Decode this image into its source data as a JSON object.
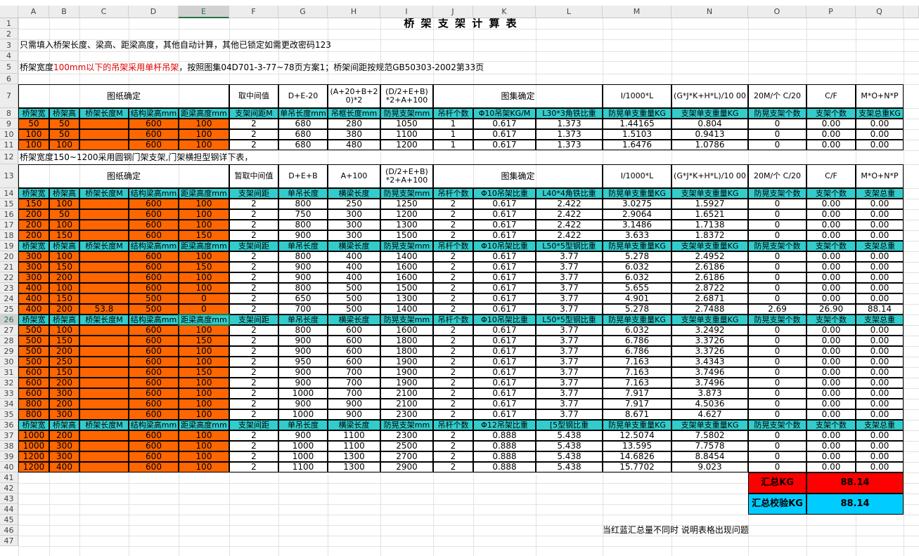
{
  "colors": {
    "orange": "#ff6600",
    "teal": "#33cccc",
    "red_total": "#ff0000",
    "blue_total": "#00ccff"
  },
  "col_letters": [
    "A",
    "B",
    "C",
    "D",
    "E",
    "F",
    "G",
    "H",
    "I",
    "J",
    "K",
    "L",
    "M",
    "N",
    "O",
    "P",
    "Q"
  ],
  "title": "桥 架 支 架 计 算 表",
  "notes": {
    "r3": "只需填入桥架长度、梁高、距梁高度，其他自动计算，其他已锁定如需更改密码123",
    "r5_a": "桥架宽度",
    "r5_b": "100mm以下的吊架采用单杆吊架",
    "r5_c": "，按照图集04D701-3-77~78页方案1；桥架间距按规范GB50303-2002第33页",
    "r12": "桥架宽度150~1200采用圆钢门架支架,门架横担型钢详下表，"
  },
  "section1_header": [
    "图纸确定",
    "取中间值",
    "D+E-20",
    "(A+20+B+2 0)*2",
    "(D/2+E+B) *2+A+100",
    "图集确定",
    "I/1000*L",
    "(G*J*K+H*L)/10 00",
    "20M/个 C/20",
    "C/F",
    "M*O+N*P"
  ],
  "section2_header": [
    "图纸确定",
    "暂取中间值",
    "D+E+B",
    "A+100",
    "(D/2+E+B) *2+A+100",
    "图集确定",
    "I/1000*L",
    "(G*J*K+H*L)/10 00",
    "20M/个 C/20",
    "C/F",
    "M*O+N*P"
  ],
  "teal_rows": {
    "r8": [
      "桥架宽",
      "桥架高",
      "桥架长度M",
      "结构梁高mm",
      "距梁高度mm",
      "支架间距M",
      "单吊长度mm",
      "吊框长度mm",
      "防晃支架mm",
      "吊杆个数",
      "Φ10吊架KG/M",
      "L30*3角铁比重",
      "防晃单支重量KG",
      "支架单支重量KG",
      "防晃支架个数",
      "支架个数",
      "支架总重KG"
    ],
    "r14": [
      "桥架宽",
      "桥架高",
      "桥架长度M",
      "结构梁高mm",
      "距梁高度mm",
      "支架间距",
      "单吊长度",
      "横梁长度",
      "防晃支架mm",
      "吊杆个数",
      "Φ10吊架比重",
      "L40*4角铁比重",
      "防晃单支重量KG",
      "支架单支重量KG",
      "防晃支架个数",
      "支架个数",
      "支架总重"
    ],
    "r19": [
      "桥架宽",
      "桥架高",
      "桥架长度M",
      "结构梁高mm",
      "距梁高度mm",
      "支架间距",
      "单吊长度",
      "横梁长度",
      "防晃支架mm",
      "吊杆个数",
      "Φ10吊架比重",
      "L50*5型钢比重",
      "防晃单支重量KG",
      "支架单支重量KG",
      "防晃支架个数",
      "支架个数",
      "支架总重"
    ],
    "r26": [
      "桥架宽",
      "桥架高",
      "桥架长度M",
      "结构梁高mm",
      "距梁高度mm",
      "支架间距",
      "单吊长度",
      "横梁长度",
      "防晃支架mm",
      "吊杆个数",
      "Φ10吊架比重",
      "L50*5型钢比重",
      "防晃单支重量KG",
      "支架单支重量KG",
      "防晃支架个数",
      "支架个数",
      "支架总重"
    ],
    "r36": [
      "桥架宽",
      "桥架高",
      "桥架长度M",
      "结构梁高mm",
      "距梁高度mm",
      "支架间距",
      "单吊长度",
      "横梁长度",
      "防晃支架mm",
      "吊杆个数",
      "Φ12吊架比重",
      "[5型钢比重",
      "防晃单支重量KG",
      "支架单支重量KG",
      "防晃支架个数",
      "支架个数",
      "支架总重"
    ]
  },
  "data_rows": [
    {
      "r": 9,
      "v": [
        "50",
        "50",
        "",
        "600",
        "100",
        "2",
        "680",
        "280",
        "1050",
        "1",
        "0.617",
        "1.373",
        "1.44165",
        "0.804",
        "0",
        "0.00",
        "0.00"
      ]
    },
    {
      "r": 10,
      "v": [
        "100",
        "50",
        "",
        "600",
        "100",
        "2",
        "680",
        "380",
        "1100",
        "1",
        "0.617",
        "1.373",
        "1.5103",
        "0.9413",
        "0",
        "0.00",
        "0.00"
      ]
    },
    {
      "r": 11,
      "v": [
        "100",
        "100",
        "",
        "600",
        "100",
        "2",
        "680",
        "480",
        "1200",
        "1",
        "0.617",
        "1.373",
        "1.6476",
        "1.0786",
        "0",
        "0.00",
        "0.00"
      ]
    },
    {
      "r": 15,
      "v": [
        "150",
        "100",
        "",
        "600",
        "100",
        "2",
        "800",
        "250",
        "1250",
        "2",
        "0.617",
        "2.422",
        "3.0275",
        "1.5927",
        "0",
        "0.00",
        "0.00"
      ]
    },
    {
      "r": 16,
      "v": [
        "200",
        "50",
        "",
        "600",
        "100",
        "2",
        "750",
        "300",
        "1200",
        "2",
        "0.617",
        "2.422",
        "2.9064",
        "1.6521",
        "0",
        "0.00",
        "0.00"
      ]
    },
    {
      "r": 17,
      "v": [
        "200",
        "100",
        "",
        "600",
        "100",
        "2",
        "800",
        "300",
        "1300",
        "2",
        "0.617",
        "2.422",
        "3.1486",
        "1.7138",
        "0",
        "0.00",
        "0.00"
      ]
    },
    {
      "r": 18,
      "v": [
        "200",
        "150",
        "",
        "600",
        "150",
        "2",
        "900",
        "300",
        "1500",
        "2",
        "0.617",
        "2.422",
        "3.633",
        "1.8372",
        "0",
        "0.00",
        "0.00"
      ]
    },
    {
      "r": 20,
      "v": [
        "300",
        "100",
        "",
        "600",
        "100",
        "2",
        "800",
        "400",
        "1400",
        "2",
        "0.617",
        "3.77",
        "5.278",
        "2.4952",
        "0",
        "0.00",
        "0.00"
      ]
    },
    {
      "r": 21,
      "v": [
        "300",
        "150",
        "",
        "600",
        "150",
        "2",
        "900",
        "400",
        "1600",
        "2",
        "0.617",
        "3.77",
        "6.032",
        "2.6186",
        "0",
        "0.00",
        "0.00"
      ]
    },
    {
      "r": 22,
      "v": [
        "300",
        "200",
        "",
        "600",
        "100",
        "2",
        "900",
        "400",
        "1600",
        "2",
        "0.617",
        "3.77",
        "6.032",
        "2.6186",
        "0",
        "0.00",
        "0.00"
      ]
    },
    {
      "r": 23,
      "v": [
        "400",
        "100",
        "",
        "600",
        "100",
        "2",
        "800",
        "500",
        "1500",
        "2",
        "0.617",
        "3.77",
        "5.655",
        "2.8722",
        "0",
        "0.00",
        "0.00"
      ]
    },
    {
      "r": 24,
      "v": [
        "400",
        "150",
        "",
        "500",
        "0",
        "2",
        "650",
        "500",
        "1300",
        "2",
        "0.617",
        "3.77",
        "4.901",
        "2.6871",
        "0",
        "0.00",
        "0.00"
      ]
    },
    {
      "r": 25,
      "v": [
        "400",
        "200",
        "53.8",
        "500",
        "0",
        "2",
        "700",
        "500",
        "1400",
        "2",
        "0.617",
        "3.77",
        "5.278",
        "2.7488",
        "2.69",
        "26.90",
        "88.14"
      ]
    },
    {
      "r": 27,
      "v": [
        "500",
        "100",
        "",
        "600",
        "100",
        "2",
        "800",
        "600",
        "1600",
        "2",
        "0.617",
        "3.77",
        "6.032",
        "3.2492",
        "0",
        "0.00",
        "0.00"
      ]
    },
    {
      "r": 28,
      "v": [
        "500",
        "150",
        "",
        "600",
        "150",
        "2",
        "900",
        "600",
        "1800",
        "2",
        "0.617",
        "3.77",
        "6.786",
        "3.3726",
        "0",
        "0.00",
        "0.00"
      ]
    },
    {
      "r": 29,
      "v": [
        "500",
        "200",
        "",
        "600",
        "100",
        "2",
        "900",
        "600",
        "1800",
        "2",
        "0.617",
        "3.77",
        "6.786",
        "3.3726",
        "0",
        "0.00",
        "0.00"
      ]
    },
    {
      "r": 30,
      "v": [
        "500",
        "250",
        "",
        "600",
        "100",
        "2",
        "950",
        "600",
        "1900",
        "2",
        "0.617",
        "3.77",
        "7.163",
        "3.4343",
        "0",
        "0.00",
        "0.00"
      ]
    },
    {
      "r": 31,
      "v": [
        "600",
        "150",
        "",
        "600",
        "150",
        "2",
        "900",
        "700",
        "1900",
        "2",
        "0.617",
        "3.77",
        "7.163",
        "3.7496",
        "0",
        "0.00",
        "0.00"
      ]
    },
    {
      "r": 32,
      "v": [
        "600",
        "200",
        "",
        "600",
        "100",
        "2",
        "900",
        "700",
        "1900",
        "2",
        "0.617",
        "3.77",
        "7.163",
        "3.7496",
        "0",
        "0.00",
        "0.00"
      ]
    },
    {
      "r": 33,
      "v": [
        "600",
        "300",
        "",
        "600",
        "100",
        "2",
        "1000",
        "700",
        "2100",
        "2",
        "0.617",
        "3.77",
        "7.917",
        "3.873",
        "0",
        "0.00",
        "0.00"
      ]
    },
    {
      "r": 34,
      "v": [
        "800",
        "200",
        "",
        "600",
        "100",
        "2",
        "900",
        "900",
        "2100",
        "2",
        "0.617",
        "3.77",
        "7.917",
        "4.5036",
        "0",
        "0.00",
        "0.00"
      ]
    },
    {
      "r": 35,
      "v": [
        "800",
        "300",
        "",
        "600",
        "100",
        "2",
        "1000",
        "900",
        "2300",
        "2",
        "0.617",
        "3.77",
        "8.671",
        "4.627",
        "0",
        "0.00",
        "0.00"
      ]
    },
    {
      "r": 37,
      "v": [
        "1000",
        "200",
        "",
        "600",
        "100",
        "2",
        "900",
        "1100",
        "2300",
        "2",
        "0.888",
        "5.438",
        "12.5074",
        "7.5802",
        "0",
        "0.00",
        "0.00"
      ]
    },
    {
      "r": 38,
      "v": [
        "1000",
        "300",
        "",
        "600",
        "100",
        "2",
        "1000",
        "1100",
        "2500",
        "2",
        "0.888",
        "5.438",
        "13.595",
        "7.7578",
        "0",
        "0.00",
        "0.00"
      ]
    },
    {
      "r": 39,
      "v": [
        "1200",
        "300",
        "",
        "600",
        "100",
        "2",
        "1000",
        "1300",
        "2700",
        "2",
        "0.888",
        "5.438",
        "14.6826",
        "8.8454",
        "0",
        "0.00",
        "0.00"
      ]
    },
    {
      "r": 40,
      "v": [
        "1200",
        "400",
        "",
        "600",
        "100",
        "2",
        "1100",
        "1300",
        "2900",
        "2",
        "0.888",
        "5.438",
        "15.7702",
        "9.023",
        "0",
        "0.00",
        "0.00"
      ]
    }
  ],
  "totals": {
    "label1": "汇总KG",
    "value1": "88.14",
    "label2": "汇总校验KG",
    "value2": "88.14"
  },
  "footnote": "当红蓝汇总量不同时 说明表格出现问题"
}
